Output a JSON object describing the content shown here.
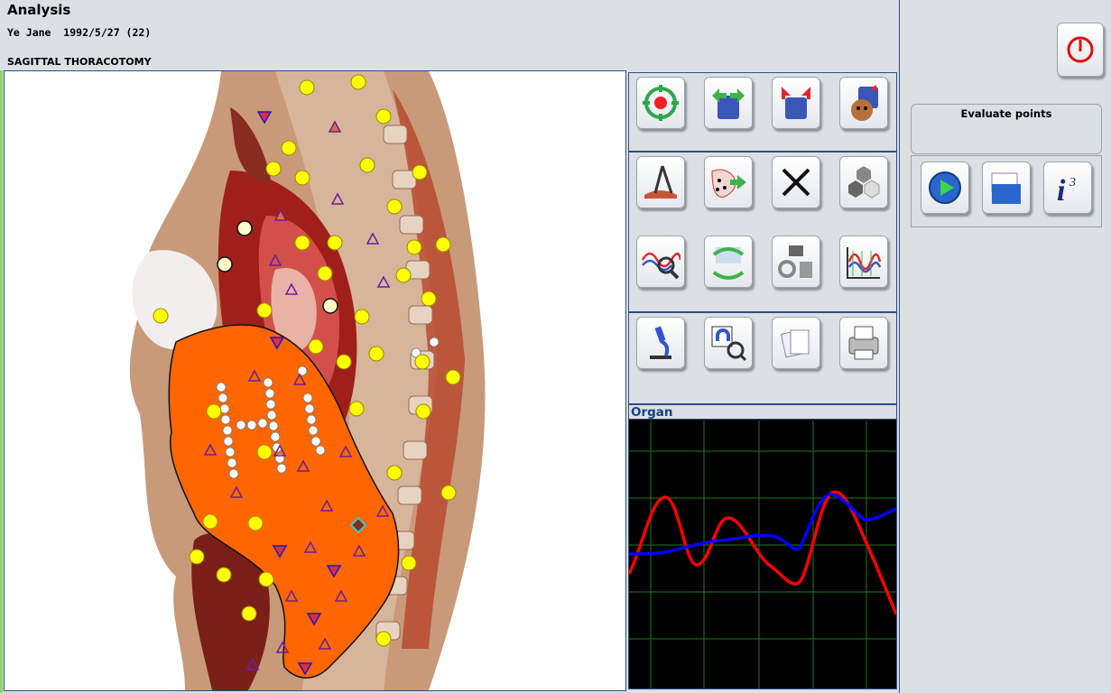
{
  "header": {
    "title": "Analysis",
    "patient": "Ye Jane  1992/5/27 (22)",
    "view_title": "SAGITTAL THORACOTOMY"
  },
  "toolbar": {
    "groups": [
      {
        "buttons": [
          {
            "name": "center-target-icon"
          },
          {
            "name": "open-bin-icon"
          },
          {
            "name": "close-bin-icon"
          },
          {
            "name": "bear-bin-icon"
          }
        ]
      },
      {
        "buttons": [
          {
            "name": "compass-measure-icon"
          },
          {
            "name": "points-export-icon"
          },
          {
            "name": "delete-x-icon"
          },
          {
            "name": "hexagons-icon"
          },
          {
            "name": "wave-magnifier-icon"
          },
          {
            "name": "recycle-docs-icon"
          },
          {
            "name": "bin-gears-icon"
          },
          {
            "name": "spectrum-chart-icon"
          }
        ]
      },
      {
        "buttons": [
          {
            "name": "microscope-icon"
          },
          {
            "name": "magnet-zoom-icon"
          },
          {
            "name": "documents-icon"
          },
          {
            "name": "print-report-icon"
          }
        ]
      }
    ]
  },
  "organ": {
    "label": "Organ",
    "colors": {
      "series_red": "#ff0000",
      "series_blue": "#0000ff",
      "grid": "#1f7a1f",
      "background": "#000000"
    }
  },
  "right_panel": {
    "power_icon": "power-icon",
    "evaluate_label": "Evaluate points",
    "buttons": [
      {
        "name": "play-icon"
      },
      {
        "name": "folder-docs-icon"
      },
      {
        "name": "info-i3-icon"
      }
    ]
  },
  "colors": {
    "highlight_region": "#ff6600",
    "marker_yellow": "#ffff00",
    "marker_triangle": "#6a1fa0",
    "marker_down": "#1a1acc",
    "accent_title": "#10418a"
  }
}
